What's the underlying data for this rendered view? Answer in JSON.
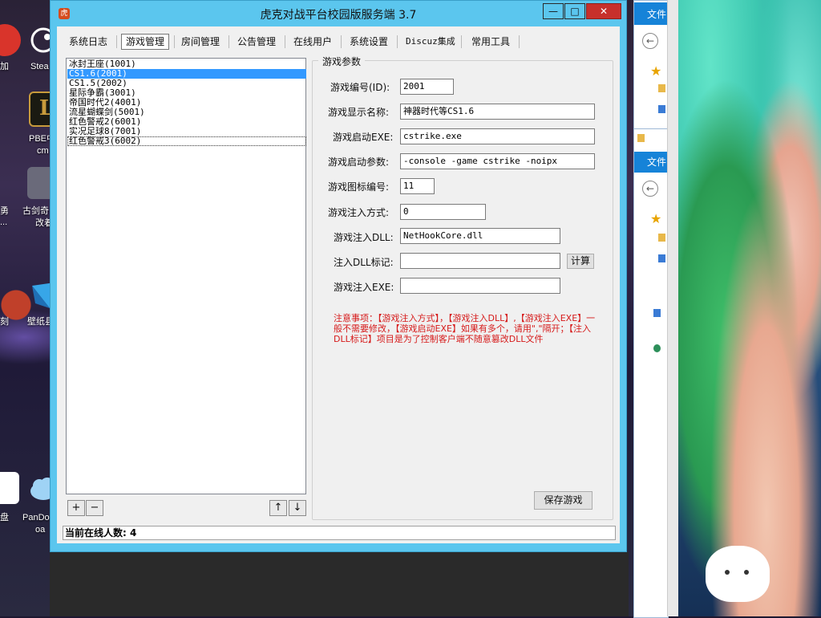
{
  "desktop": {
    "icons": [
      {
        "label": "加"
      },
      {
        "label": "Stea"
      },
      {
        "label": "PBE中"
      },
      {
        "label": "cm"
      },
      {
        "label": "勇"
      },
      {
        "label": "..."
      },
      {
        "label": "古剑奇"
      },
      {
        "label": "改着"
      },
      {
        "label": "刻"
      },
      {
        "label": "壁纸县"
      },
      {
        "label": "盘"
      },
      {
        "label": "PanDo"
      },
      {
        "label": "oa"
      }
    ]
  },
  "explorer_windows": [
    {
      "title": "文件"
    },
    {
      "title": "文件"
    }
  ],
  "window": {
    "title": "虎克对战平台校园版服务端 3.7",
    "controls": {
      "minimize": "—",
      "maximize": "□",
      "close": "✕"
    }
  },
  "tabs": [
    "系统日志",
    "游戏管理",
    "房间管理",
    "公告管理",
    "在线用户",
    "系统设置",
    "Discuz集成",
    "常用工具"
  ],
  "active_tab": "游戏管理",
  "game_list": [
    "冰封王座(1001)",
    "CS1.6(2001)",
    "CS1.5(2002)",
    "星际争霸(3001)",
    "帝国时代2(4001)",
    "流星蝴蝶剑(5001)",
    "红色警戒2(6001)",
    "实况足球8(7001)",
    "红色警戒3(6002)"
  ],
  "list_buttons": {
    "add": "+",
    "remove": "−",
    "up": "↑",
    "down": "↓"
  },
  "params": {
    "group_title": "游戏参数",
    "game_id_label": "游戏编号(ID):",
    "game_id": "2001",
    "display_name_label": "游戏显示名称:",
    "display_name": "神器时代等CS1.6",
    "exe_label": "游戏启动EXE:",
    "exe": "cstrike.exe",
    "args_label": "游戏启动参数:",
    "args": "-console -game cstrike -noipx",
    "icon_id_label": "游戏图标编号:",
    "icon_id": "11",
    "inject_mode_label": "游戏注入方式:",
    "inject_mode": "0",
    "inject_dll_label": "游戏注入DLL:",
    "inject_dll": "NetHookCore.dll",
    "dll_mark_label": "注入DLL标记:",
    "dll_mark": "",
    "calc_button": "计算",
    "inject_exe_label": "游戏注入EXE:",
    "inject_exe": "",
    "notice": "注意事项：【游戏注入方式】，【游戏注入DLL】,【游戏注入EXE】一般不需要修改，【游戏启动EXE】如果有多个，请用\",\"隔开；【注入DLL标记】项目是为了控制客户端不随意篡改DLL文件",
    "save_button": "保存游戏"
  },
  "status": "当前在线人数: 4",
  "colors": {
    "window_frame": "#5bc6ee",
    "close_button": "#c7302b",
    "selection": "#3399ff",
    "notice_text": "#d61a1a",
    "explorer_title": "#1683d8"
  }
}
